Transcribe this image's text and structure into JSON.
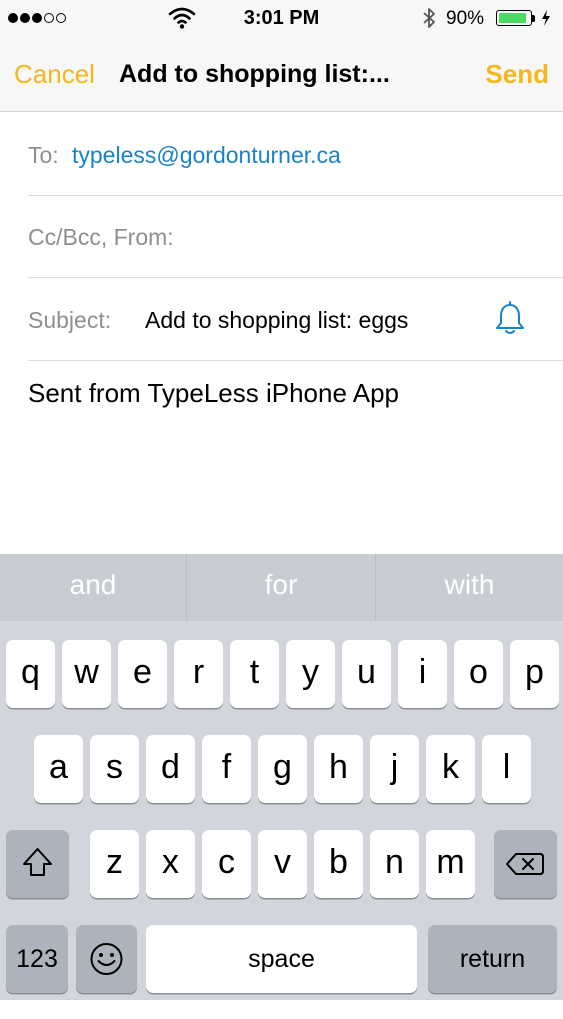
{
  "status_bar": {
    "time": "3:01 PM",
    "battery_percent": "90%",
    "battery_level": 0.9,
    "signal_bars_filled": 3,
    "signal_bars_total": 5,
    "icons": [
      "signal-dots-icon",
      "wifi-icon",
      "bluetooth-icon",
      "battery-icon",
      "charging-bolt-icon"
    ]
  },
  "nav": {
    "cancel": "Cancel",
    "title": "Add to shopping list:...",
    "send": "Send",
    "accent_color": "#f2b81c"
  },
  "compose": {
    "to_label": "To:",
    "to_value": "typeless@gordonturner.ca",
    "cc_label": "Cc/Bcc, From:",
    "subject_label": "Subject:",
    "subject_value": "Add to shopping list: eggs",
    "body": "Sent from TypeLess iPhone App",
    "link_color": "#1a82c8",
    "subject_icon": "bell-icon"
  },
  "keyboard": {
    "suggestions": [
      "and",
      "for",
      "with"
    ],
    "row1": [
      "q",
      "w",
      "e",
      "r",
      "t",
      "y",
      "u",
      "i",
      "o",
      "p"
    ],
    "row2": [
      "a",
      "s",
      "d",
      "f",
      "g",
      "h",
      "j",
      "k",
      "l"
    ],
    "row3": [
      "z",
      "x",
      "c",
      "v",
      "b",
      "n",
      "m"
    ],
    "numbers": "123",
    "space": "space",
    "return": "return",
    "shift_icon": "shift-icon",
    "delete_icon": "delete-icon",
    "emoji_icon": "emoji-icon"
  }
}
